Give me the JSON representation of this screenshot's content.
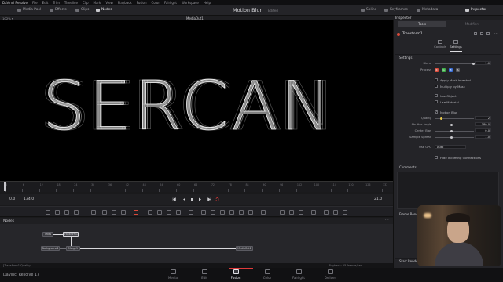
{
  "menubar": {
    "app": "DaVinci Resolve",
    "items": [
      "File",
      "Edit",
      "Trim",
      "Timeline",
      "Clip",
      "Mark",
      "View",
      "Playback",
      "Fusion",
      "Color",
      "Fairlight",
      "Workspace",
      "Help"
    ]
  },
  "toolbar": {
    "media_pool": "Media Pool",
    "effects": "Effects",
    "clips": "Clips",
    "nodes": "Nodes",
    "spline": "Spline",
    "keyframes": "Keyframes",
    "metadata": "Metadata",
    "inspector": "Inspector"
  },
  "page": {
    "title": "Motion Blur",
    "status": "Edited"
  },
  "viewer": {
    "zoom": "102% ▾",
    "output": "MediaOut1",
    "text": "SERCAN"
  },
  "ruler": {
    "ticks": [
      "0",
      "6",
      "12",
      "18",
      "24",
      "30",
      "36",
      "42",
      "48",
      "54",
      "60",
      "66",
      "72",
      "78",
      "84",
      "90",
      "96",
      "102",
      "108",
      "114",
      "120",
      "126",
      "132"
    ]
  },
  "transport": {
    "start": "0.0",
    "end": "134.0",
    "current": "21.0"
  },
  "nodes": {
    "title": "Nodes",
    "items": [
      {
        "label": "Text1"
      },
      {
        "label": "Transform1"
      },
      {
        "label": "Background1"
      },
      {
        "label": "Merge1"
      },
      {
        "label": "MediaOut1"
      }
    ]
  },
  "status": {
    "left": "[Transform1.Quality]",
    "right": "Playback: 25 frames/sec"
  },
  "pages": [
    "Media",
    "Edit",
    "Fusion",
    "Color",
    "Fairlight",
    "Deliver"
  ],
  "active_page": "Fusion",
  "app_name": "DaVinci Resolve 17",
  "inspector": {
    "title": "Inspector",
    "tabs": {
      "tools": "Tools",
      "modifiers": "Modifiers"
    },
    "tool": "Transform1",
    "subtabs": {
      "controls": "Controls",
      "settings": "Settings"
    },
    "section": "Settings",
    "blend": {
      "label": "Blend",
      "value": "1.0"
    },
    "process": {
      "label": "Process",
      "channels": [
        "R",
        "G",
        "B",
        "A"
      ]
    },
    "checkboxes": {
      "apply_mask_inverted": "Apply Mask Inverted",
      "multiply_by_mask": "Multiply by Mask",
      "use_object": "Use Object",
      "use_material": "Use Material",
      "motion_blur": "Motion Blur"
    },
    "quality": {
      "label": "Quality",
      "value": "2"
    },
    "shutter_angle": {
      "label": "Shutter Angle",
      "value": "180.0"
    },
    "center_bias": {
      "label": "Center Bias",
      "value": "0.0"
    },
    "sample_spread": {
      "label": "Sample Spread",
      "value": "1.0"
    },
    "use_gpu": {
      "label": "Use GPU",
      "value": "Auto"
    },
    "hide_incoming": "Hide Incoming Connections",
    "comments": "Comments",
    "frame_render_script": "Frame Render Script",
    "start_render_scripts": "Start Render Scripts"
  },
  "colors": {
    "accent_red": "#e03a3a",
    "red": "#d84a3a",
    "green": "#3fae4a",
    "blue": "#3a6fd8"
  }
}
